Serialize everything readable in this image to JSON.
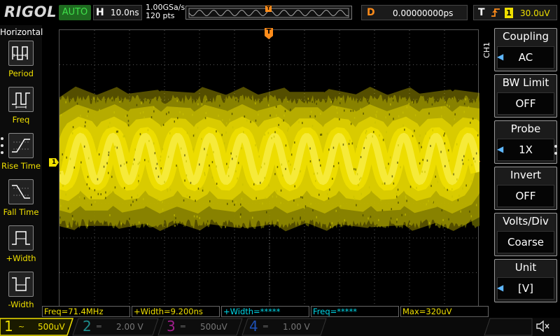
{
  "top": {
    "logo": "RIGOL",
    "run_state": "AUTO",
    "horizontal_label": "H",
    "timebase": "10.0ns",
    "sample_rate": "1.00GSa/s",
    "memory_depth": "120 pts",
    "delay_label": "D",
    "delay_value": "0.00000000ps",
    "trigger_label": "T",
    "trigger_type_icon": "rising-edge-icon",
    "trigger_source": "1",
    "trigger_level": "30.0uV",
    "trigger_marker": "T"
  },
  "left_menu": {
    "title": "Horizontal",
    "items": [
      {
        "label": "Period",
        "icon": "period-icon"
      },
      {
        "label": "Freq",
        "icon": "frequency-icon"
      },
      {
        "label": "Rise Time",
        "icon": "rise-time-icon"
      },
      {
        "label": "Fall Time",
        "icon": "fall-time-icon"
      },
      {
        "label": "+Width",
        "icon": "positive-width-icon"
      },
      {
        "label": "-Width",
        "icon": "negative-width-icon"
      }
    ]
  },
  "right_menu": {
    "channel_tab": "CH1",
    "items": [
      {
        "title": "Coupling",
        "value": "AC",
        "has_arrow": true
      },
      {
        "title": "BW Limit",
        "value": "OFF",
        "has_arrow": false
      },
      {
        "title": "Probe",
        "value": "1X",
        "has_arrow": true
      },
      {
        "title": "Invert",
        "value": "OFF",
        "has_arrow": false
      },
      {
        "title": "Volts/Div",
        "value": "Coarse",
        "has_arrow": false
      },
      {
        "title": "Unit",
        "value": "[V]",
        "has_arrow": true
      }
    ]
  },
  "measurements": [
    {
      "text": "Freq=71.4MHz",
      "color": "#f0e000"
    },
    {
      "text": "+Width=9.200ns",
      "color": "#f0e000"
    },
    {
      "text": "+Width=*****",
      "color": "#00d8e8"
    },
    {
      "text": "Freq=*****",
      "color": "#00d8e8"
    },
    {
      "text": "Max=320uV",
      "color": "#f0e000"
    }
  ],
  "channels": [
    {
      "number": "1",
      "coupling_icon": "ac-coupling-icon",
      "scale": "500uV",
      "color": "#f0e000",
      "active": true
    },
    {
      "number": "2",
      "coupling_icon": "dc-coupling-icon",
      "scale": "2.00 V",
      "color": "#1e8c8c",
      "active": false
    },
    {
      "number": "3",
      "coupling_icon": "dc-coupling-icon",
      "scale": "500uV",
      "color": "#a01e8c",
      "active": false
    },
    {
      "number": "4",
      "coupling_icon": "dc-coupling-icon",
      "scale": "1.00 V",
      "color": "#1e50b4",
      "active": false
    }
  ],
  "markers": {
    "channel1": "1",
    "trigger_level": "T",
    "trigger_position": "T"
  },
  "waveform": {
    "color": "#f0e000",
    "cycles": 13
  },
  "speaker_icon": "speaker-muted-icon"
}
